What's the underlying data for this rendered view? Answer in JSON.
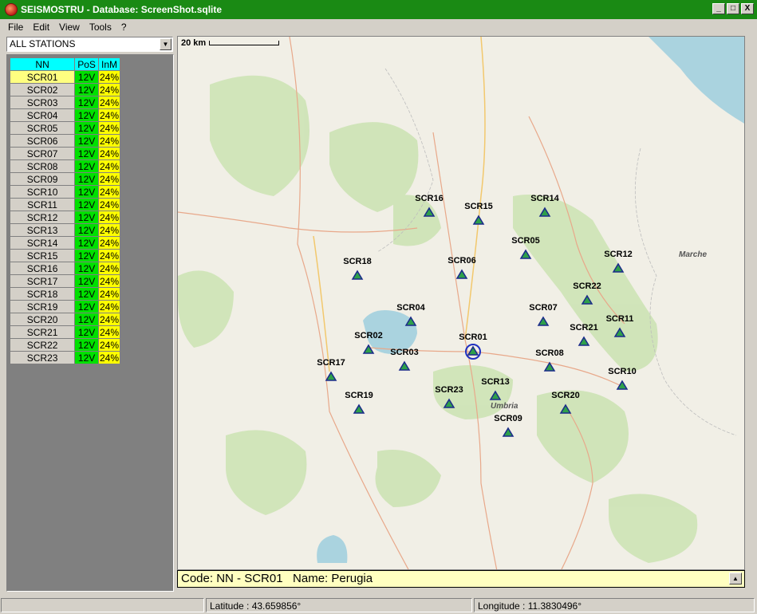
{
  "window": {
    "title": "SEISMOSTRU - Database: ScreenShot.sqlite",
    "minimize": "_",
    "maximize": "□",
    "close": "X"
  },
  "menu": [
    "File",
    "Edit",
    "View",
    "Tools",
    "?"
  ],
  "station_filter": {
    "selected": "ALL STATIONS"
  },
  "table": {
    "headers": {
      "nn": "NN",
      "pos": "PoS",
      "inm": "InM"
    },
    "rows": [
      {
        "nn": "SCR01",
        "pos": "12V",
        "inm": "24%",
        "selected": true
      },
      {
        "nn": "SCR02",
        "pos": "12V",
        "inm": "24%"
      },
      {
        "nn": "SCR03",
        "pos": "12V",
        "inm": "24%"
      },
      {
        "nn": "SCR04",
        "pos": "12V",
        "inm": "24%"
      },
      {
        "nn": "SCR05",
        "pos": "12V",
        "inm": "24%"
      },
      {
        "nn": "SCR06",
        "pos": "12V",
        "inm": "24%"
      },
      {
        "nn": "SCR07",
        "pos": "12V",
        "inm": "24%"
      },
      {
        "nn": "SCR08",
        "pos": "12V",
        "inm": "24%"
      },
      {
        "nn": "SCR09",
        "pos": "12V",
        "inm": "24%"
      },
      {
        "nn": "SCR10",
        "pos": "12V",
        "inm": "24%"
      },
      {
        "nn": "SCR11",
        "pos": "12V",
        "inm": "24%"
      },
      {
        "nn": "SCR12",
        "pos": "12V",
        "inm": "24%"
      },
      {
        "nn": "SCR13",
        "pos": "12V",
        "inm": "24%"
      },
      {
        "nn": "SCR14",
        "pos": "12V",
        "inm": "24%"
      },
      {
        "nn": "SCR15",
        "pos": "12V",
        "inm": "24%"
      },
      {
        "nn": "SCR16",
        "pos": "12V",
        "inm": "24%"
      },
      {
        "nn": "SCR17",
        "pos": "12V",
        "inm": "24%"
      },
      {
        "nn": "SCR18",
        "pos": "12V",
        "inm": "24%"
      },
      {
        "nn": "SCR19",
        "pos": "12V",
        "inm": "24%"
      },
      {
        "nn": "SCR20",
        "pos": "12V",
        "inm": "24%"
      },
      {
        "nn": "SCR21",
        "pos": "12V",
        "inm": "24%"
      },
      {
        "nn": "SCR22",
        "pos": "12V",
        "inm": "24%"
      },
      {
        "nn": "SCR23",
        "pos": "12V",
        "inm": "24%"
      }
    ]
  },
  "map": {
    "scale_label": "20 km",
    "region_labels": [
      "Marche",
      "Umbria"
    ],
    "stations": [
      "SCR01",
      "SCR02",
      "SCR03",
      "SCR04",
      "SCR05",
      "SCR06",
      "SCR07",
      "SCR08",
      "SCR09",
      "SCR10",
      "SCR11",
      "SCR12",
      "SCR13",
      "SCR14",
      "SCR15",
      "SCR16",
      "SCR17",
      "SCR18",
      "SCR19",
      "SCR20",
      "SCR21",
      "SCR22",
      "SCR23"
    ],
    "selected_station": "SCR01"
  },
  "info_bar": {
    "text": "Code: NN - SCR01   Name: Perugia"
  },
  "status": {
    "latitude": "Latitude : 43.659856°",
    "longitude": "Longitude : 11.3830496°"
  },
  "colors": {
    "titlebar": "#1a8a14",
    "marker_fill": "#2ea04a",
    "marker_stroke": "#1a2a8a",
    "pos_ok": "#00e000",
    "inm": "#ffff00",
    "header": "#00ffff"
  }
}
